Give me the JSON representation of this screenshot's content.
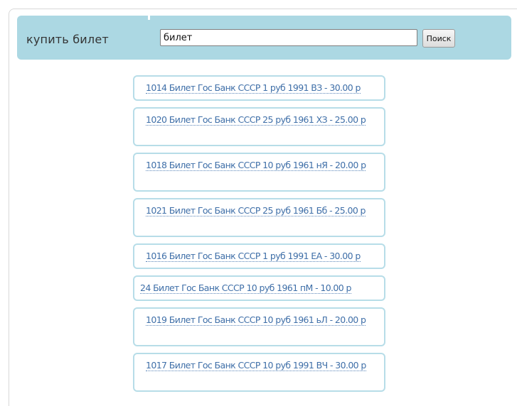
{
  "header": {
    "title": "купить билет",
    "search_value": "билет",
    "search_button": "Поиск"
  },
  "results": [
    {
      "text": "1014 Билет Гос Банк СССР 1 руб 1991 ВЗ - 30.00 р",
      "lines": 1,
      "indent": true
    },
    {
      "text": "1020 Билет Гос Банк СССР 25 руб 1961 ХЗ - 25.00 р",
      "lines": 2,
      "indent": true
    },
    {
      "text": "1018 Билет Гос Банк СССР 10 руб 1961 нЯ - 20.00 р",
      "lines": 2,
      "indent": true
    },
    {
      "text": "1021 Билет Гос Банк СССР 25 руб 1961 Бб - 25.00 р",
      "lines": 2,
      "indent": true
    },
    {
      "text": "1016 Билет Гос Банк СССР 1 руб 1991 ЕА - 30.00 р",
      "lines": 1,
      "indent": true
    },
    {
      "text": "24 Билет Гос Банк СССР 10 руб 1961 пМ - 10.00 р",
      "lines": 1,
      "indent": false
    },
    {
      "text": "1019 Билет Гос Банк СССР 10 руб 1961 ьЛ - 20.00 р",
      "lines": 2,
      "indent": true
    },
    {
      "text": "1017 Билет Гос Банк СССР 10 руб 1991 ВЧ - 30.00 р",
      "lines": 2,
      "indent": true
    }
  ]
}
